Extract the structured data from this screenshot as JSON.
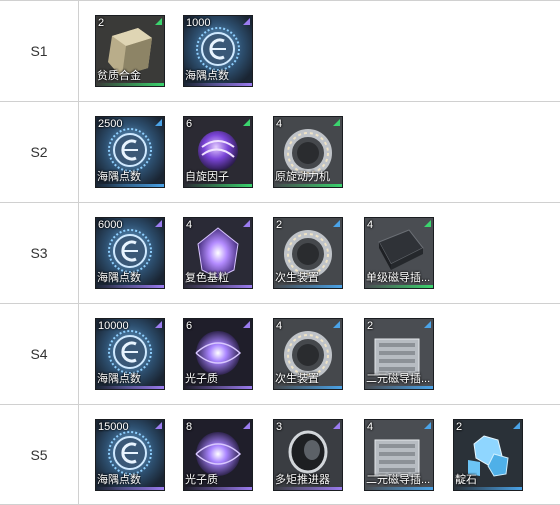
{
  "rarity_colors": {
    "green": "#3bd46e",
    "purple": "#9b7cf0",
    "blue": "#4aa3e8"
  },
  "rows": [
    {
      "stage": "S1",
      "items": [
        {
          "qty": "2",
          "name": "贫质合金",
          "rarity": "green",
          "icon": "ingot-icon"
        },
        {
          "qty": "1000",
          "name": "海隅点数",
          "rarity": "purple",
          "icon": "coin-icon"
        }
      ]
    },
    {
      "stage": "S2",
      "items": [
        {
          "qty": "2500",
          "name": "海隅点数",
          "rarity": "blue",
          "icon": "coin-icon"
        },
        {
          "qty": "6",
          "name": "自旋因子",
          "rarity": "green",
          "icon": "orb-icon"
        },
        {
          "qty": "4",
          "name": "原旋动力机",
          "rarity": "green",
          "icon": "ring-icon"
        }
      ]
    },
    {
      "stage": "S3",
      "items": [
        {
          "qty": "6000",
          "name": "海隅点数",
          "rarity": "purple",
          "icon": "coin-icon"
        },
        {
          "qty": "4",
          "name": "复色基粒",
          "rarity": "purple",
          "icon": "crystal-icon"
        },
        {
          "qty": "2",
          "name": "次生装置",
          "rarity": "blue",
          "icon": "ring-icon"
        },
        {
          "qty": "4",
          "name": "单级磁导插...",
          "rarity": "green",
          "icon": "plate-icon"
        }
      ]
    },
    {
      "stage": "S4",
      "items": [
        {
          "qty": "10000",
          "name": "海隅点数",
          "rarity": "purple",
          "icon": "coin-icon"
        },
        {
          "qty": "6",
          "name": "光子质",
          "rarity": "purple",
          "icon": "vortex-icon"
        },
        {
          "qty": "4",
          "name": "次生装置",
          "rarity": "blue",
          "icon": "ring-icon"
        },
        {
          "qty": "2",
          "name": "二元磁导插...",
          "rarity": "blue",
          "icon": "container-icon"
        }
      ]
    },
    {
      "stage": "S5",
      "items": [
        {
          "qty": "15000",
          "name": "海隅点数",
          "rarity": "purple",
          "icon": "coin-icon"
        },
        {
          "qty": "8",
          "name": "光子质",
          "rarity": "purple",
          "icon": "vortex-icon"
        },
        {
          "qty": "3",
          "name": "多矩推进器",
          "rarity": "purple",
          "icon": "lens-icon"
        },
        {
          "qty": "4",
          "name": "二元磁导插...",
          "rarity": "blue",
          "icon": "container-icon"
        },
        {
          "qty": "2",
          "name": "靛石",
          "rarity": "blue",
          "icon": "gem-icon"
        }
      ]
    }
  ]
}
